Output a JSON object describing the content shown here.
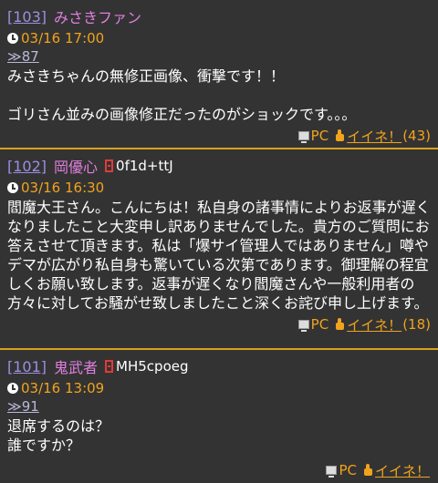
{
  "posts": [
    {
      "number": "[103]",
      "name": "みさきファン",
      "trip": "",
      "date": "03/16 17:00",
      "reply_to": "≫87",
      "body": "みさきちゃんの無修正画像、衝撃です！！\n\nゴリさん並みの画像修正だったのがショックです。。。",
      "device": "PC",
      "like_label": "イイネ！",
      "like_count": "(43)"
    },
    {
      "number": "[102]",
      "name": "岡優心",
      "trip": "0f1d+ttJ",
      "date": "03/16 16:30",
      "reply_to": "",
      "body": "閻魔大王さん。こんにちは！私自身の諸事情によりお返事が遅くなりましたこと大変申し訳ありませんでした。貴方のご質問にお答えさせて頂きます。私は「爆サイ管理人ではありません」噂やデマが広がり私自身も驚いている次第であります。御理解の程宜しくお願い致します。返事が遅くなり閻魔さんや一般利用者の方々に対してお騒がせ致しましたこと深くお詫び申し上げます。",
      "device": "PC",
      "like_label": "イイネ！",
      "like_count": "(18)"
    },
    {
      "number": "[101]",
      "name": "鬼武者",
      "trip": "MH5cpoeg",
      "date": "03/16 13:09",
      "reply_to": "≫91",
      "body": "退席するのは？\n誰ですか？",
      "device": "PC",
      "like_label": "イイネ！",
      "like_count": ""
    }
  ],
  "colors": {
    "background": "#333333",
    "separator": "#d8a21e",
    "number": "#9e8ee0",
    "name": "#e17fe0",
    "date": "#f1a31d",
    "trip_icon": "#e23a3a"
  }
}
